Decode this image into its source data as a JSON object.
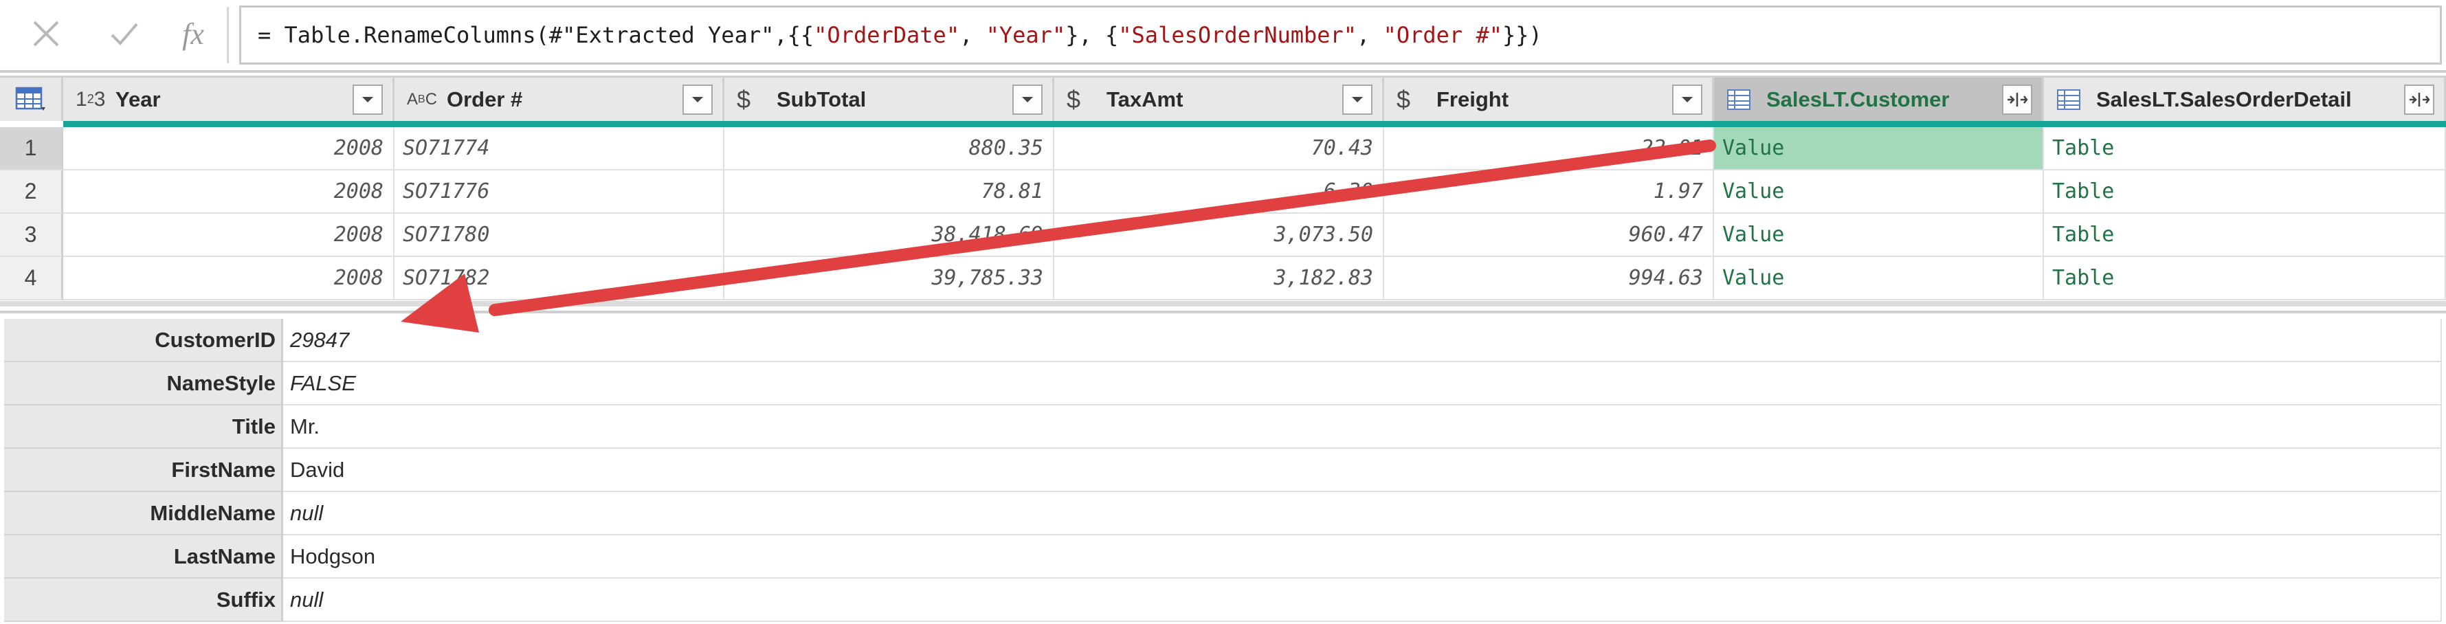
{
  "formula_bar": {
    "cancel_icon": "x-icon",
    "confirm_icon": "check-icon",
    "fx_label": "fx",
    "formula": {
      "prefix": "= Table.RenameColumns(#\"Extracted Year\",{{",
      "s1": "\"OrderDate\"",
      "sep1": ", ",
      "s2": "\"Year\"",
      "mid": "}, {",
      "s3": "\"SalesOrderNumber\"",
      "sep2": ", ",
      "s4": "\"Order #\"",
      "suffix": "}})"
    }
  },
  "columns": [
    {
      "name": "Year",
      "type_icon": "123"
    },
    {
      "name": "Order #",
      "type_icon": "ABC"
    },
    {
      "name": "SubTotal",
      "type_icon": "$"
    },
    {
      "name": "TaxAmt",
      "type_icon": "$"
    },
    {
      "name": "Freight",
      "type_icon": "$"
    },
    {
      "name": "SalesLT.Customer",
      "type_icon": "table"
    },
    {
      "name": "SalesLT.SalesOrderDetail",
      "type_icon": "table"
    }
  ],
  "rows": [
    {
      "n": "1",
      "year": "2008",
      "order": "SO71774",
      "subtotal": "880.35",
      "tax": "70.43",
      "freight": "22.01",
      "customer": "Value",
      "detail": "Table"
    },
    {
      "n": "2",
      "year": "2008",
      "order": "SO71776",
      "subtotal": "78.81",
      "tax": "6.30",
      "freight": "1.97",
      "customer": "Value",
      "detail": "Table"
    },
    {
      "n": "3",
      "year": "2008",
      "order": "SO71780",
      "subtotal": "38,418.69",
      "tax": "3,073.50",
      "freight": "960.47",
      "customer": "Value",
      "detail": "Table"
    },
    {
      "n": "4",
      "year": "2008",
      "order": "SO71782",
      "subtotal": "39,785.33",
      "tax": "3,182.83",
      "freight": "994.63",
      "customer": "Value",
      "detail": "Table"
    }
  ],
  "preview": [
    {
      "key": "CustomerID",
      "value": "29847",
      "italic": true
    },
    {
      "key": "NameStyle",
      "value": "FALSE",
      "italic": true
    },
    {
      "key": "Title",
      "value": "Mr.",
      "italic": false
    },
    {
      "key": "FirstName",
      "value": "David",
      "italic": false
    },
    {
      "key": "MiddleName",
      "value": "null",
      "italic": true
    },
    {
      "key": "LastName",
      "value": "Hodgson",
      "italic": false
    },
    {
      "key": "Suffix",
      "value": "null",
      "italic": true
    }
  ],
  "colors": {
    "accent_teal": "#17a597",
    "link_green": "#217346",
    "selected_cell": "#a3d9b8",
    "arrow_red": "#e04040"
  }
}
